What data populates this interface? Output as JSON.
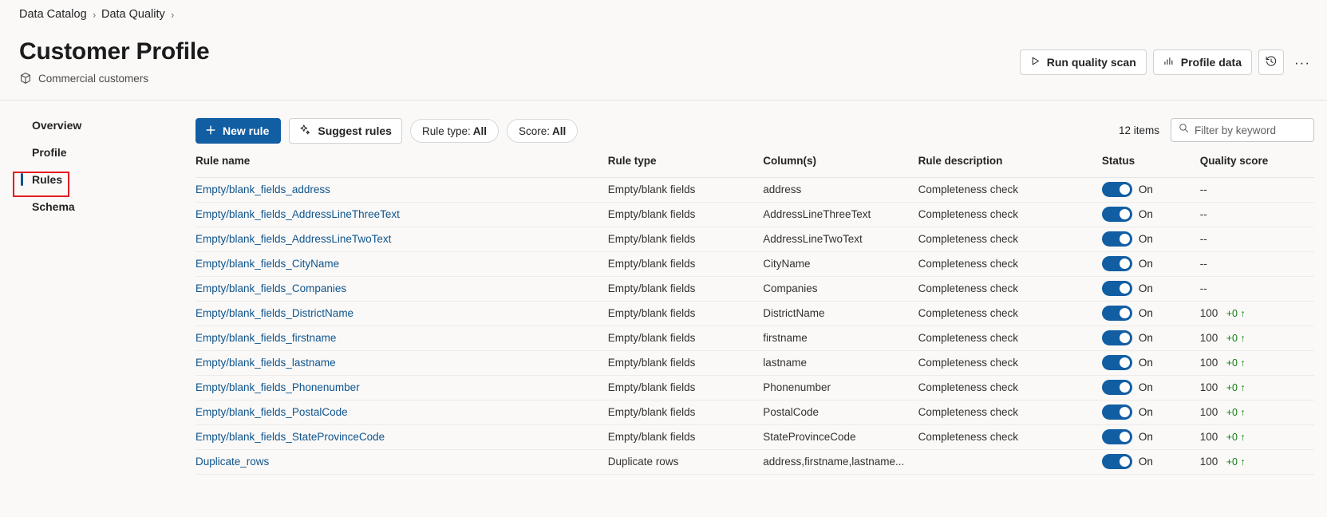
{
  "breadcrumb": {
    "items": [
      "Data Catalog",
      "Data Quality"
    ],
    "separator": "›"
  },
  "header": {
    "title": "Customer Profile",
    "subtitle": "Commercial customers",
    "subtitle_icon": "cube-icon",
    "actions": {
      "run_quality_scan": "Run quality scan",
      "run_quality_scan_icon": "play-icon",
      "profile_data": "Profile data",
      "profile_data_icon": "bar-chart-icon",
      "history_icon": "history-clock-icon",
      "more_label": "···",
      "more_icon": "more-horizontal-icon"
    }
  },
  "sidebar": {
    "items": [
      {
        "label": "Overview",
        "selected": false
      },
      {
        "label": "Profile",
        "selected": false
      },
      {
        "label": "Rules",
        "selected": true
      },
      {
        "label": "Schema",
        "selected": false
      }
    ],
    "annotation_color": "#e31b23",
    "selection_color": "#0f548c"
  },
  "toolbar": {
    "new_rule": "New rule",
    "new_rule_icon": "plus-icon",
    "suggest_rules": "Suggest rules",
    "suggest_rules_icon": "sparkle-icon",
    "filter_rule_type_label": "Rule type:",
    "filter_rule_type_value": "All",
    "filter_score_label": "Score:",
    "filter_score_value": "All",
    "item_count": "12 items",
    "search_placeholder": "Filter by keyword",
    "search_value": "",
    "search_icon": "search-icon"
  },
  "table": {
    "columns": [
      "Rule name",
      "Rule type",
      "Column(s)",
      "Rule description",
      "Status",
      "Quality score"
    ],
    "rows": [
      {
        "name": "Empty/blank_fields_address",
        "type": "Empty/blank fields",
        "columns": "address",
        "description": "Completeness check",
        "status": "On",
        "score": "--",
        "delta": ""
      },
      {
        "name": "Empty/blank_fields_AddressLineThreeText",
        "type": "Empty/blank fields",
        "columns": "AddressLineThreeText",
        "description": "Completeness check",
        "status": "On",
        "score": "--",
        "delta": ""
      },
      {
        "name": "Empty/blank_fields_AddressLineTwoText",
        "type": "Empty/blank fields",
        "columns": "AddressLineTwoText",
        "description": "Completeness check",
        "status": "On",
        "score": "--",
        "delta": ""
      },
      {
        "name": "Empty/blank_fields_CityName",
        "type": "Empty/blank fields",
        "columns": "CityName",
        "description": "Completeness check",
        "status": "On",
        "score": "--",
        "delta": ""
      },
      {
        "name": "Empty/blank_fields_Companies",
        "type": "Empty/blank fields",
        "columns": "Companies",
        "description": "Completeness check",
        "status": "On",
        "score": "--",
        "delta": ""
      },
      {
        "name": "Empty/blank_fields_DistrictName",
        "type": "Empty/blank fields",
        "columns": "DistrictName",
        "description": "Completeness check",
        "status": "On",
        "score": "100",
        "delta": "+0 ↑"
      },
      {
        "name": "Empty/blank_fields_firstname",
        "type": "Empty/blank fields",
        "columns": "firstname",
        "description": "Completeness check",
        "status": "On",
        "score": "100",
        "delta": "+0 ↑"
      },
      {
        "name": "Empty/blank_fields_lastname",
        "type": "Empty/blank fields",
        "columns": "lastname",
        "description": "Completeness check",
        "status": "On",
        "score": "100",
        "delta": "+0 ↑"
      },
      {
        "name": "Empty/blank_fields_Phonenumber",
        "type": "Empty/blank fields",
        "columns": "Phonenumber",
        "description": "Completeness check",
        "status": "On",
        "score": "100",
        "delta": "+0 ↑"
      },
      {
        "name": "Empty/blank_fields_PostalCode",
        "type": "Empty/blank fields",
        "columns": "PostalCode",
        "description": "Completeness check",
        "status": "On",
        "score": "100",
        "delta": "+0 ↑"
      },
      {
        "name": "Empty/blank_fields_StateProvinceCode",
        "type": "Empty/blank fields",
        "columns": "StateProvinceCode",
        "description": "Completeness check",
        "status": "On",
        "score": "100",
        "delta": "+0 ↑"
      },
      {
        "name": "Duplicate_rows",
        "type": "Duplicate rows",
        "columns": "address,firstname,lastname...",
        "description": "",
        "status": "On",
        "score": "100",
        "delta": "+0 ↑"
      }
    ]
  },
  "colors": {
    "primary": "#115ea3",
    "link": "#0f548c",
    "toggle_on": "#115ea3",
    "delta_positive": "#107c10",
    "annotation": "#e31b23"
  }
}
